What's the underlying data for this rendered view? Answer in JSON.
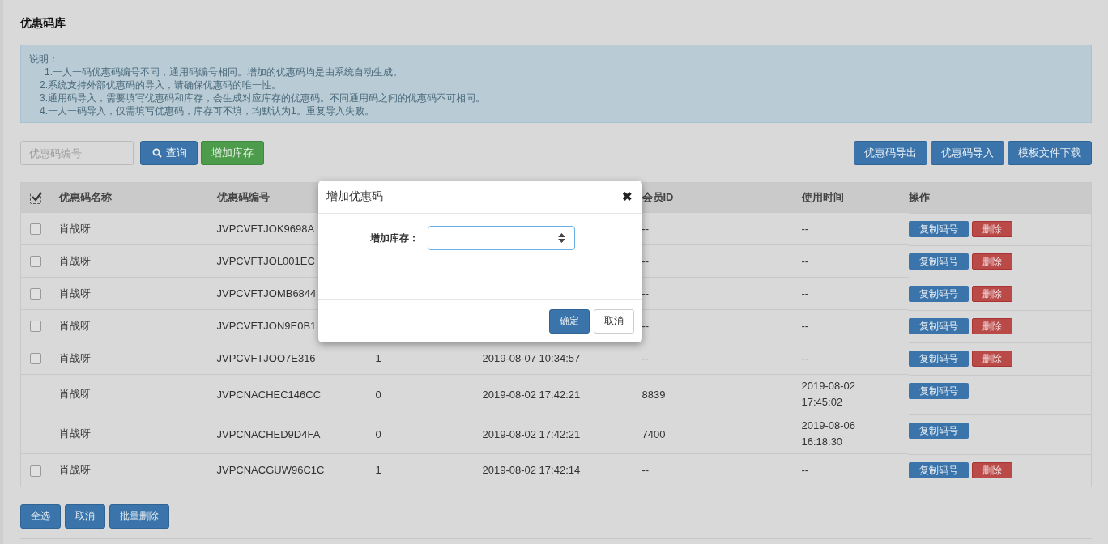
{
  "page_title": "优惠码库",
  "notice": {
    "heading": "说明：",
    "lines": [
      "1.一人一码优惠码编号不同，通用码编号相同。增加的优惠码均是由系统自动生成。",
      "2.系统支持外部优惠码的导入，请确保优惠码的唯一性。",
      "3.通用码导入，需要填写优惠码和库存，会生成对应库存的优惠码。不同通用码之间的优惠码不可相同。",
      "4.一人一码导入，仅需填写优惠码，库存可不填，均默认为1。重复导入失败。"
    ]
  },
  "search": {
    "placeholder": "优惠码编号",
    "query_button": "查询",
    "add_stock_button": "增加库存"
  },
  "toolbar_buttons": [
    "优惠码导出",
    "优惠码导入",
    "模板文件下载"
  ],
  "table": {
    "select_all_checked": true,
    "columns": [
      "优惠码名称",
      "优惠码编号",
      "",
      "",
      "会员ID",
      "使用时间",
      "操作"
    ],
    "rows": [
      {
        "checked": false,
        "name": "肖战呀",
        "code": "JVPCVFTJOK9698A",
        "member_id": "--",
        "used_time": "--",
        "actions": [
          {
            "kind": "copy",
            "label": "复制码号"
          },
          {
            "kind": "delete",
            "label": "删除"
          }
        ]
      },
      {
        "checked": false,
        "name": "肖战呀",
        "code": "JVPCVFTJOL001EC",
        "member_id": "--",
        "used_time": "--",
        "actions": [
          {
            "kind": "copy",
            "label": "复制码号"
          },
          {
            "kind": "delete",
            "label": "删除"
          }
        ]
      },
      {
        "checked": false,
        "name": "肖战呀",
        "code": "JVPCVFTJOMB6844",
        "member_id": "--",
        "used_time": "--",
        "actions": [
          {
            "kind": "copy",
            "label": "复制码号"
          },
          {
            "kind": "delete",
            "label": "删除"
          }
        ]
      },
      {
        "checked": false,
        "name": "肖战呀",
        "code": "JVPCVFTJON9E0B1",
        "member_id": "--",
        "used_time": "--",
        "actions": [
          {
            "kind": "copy",
            "label": "复制码号"
          },
          {
            "kind": "delete",
            "label": "删除"
          }
        ]
      },
      {
        "checked": false,
        "name": "肖战呀",
        "code": "JVPCVFTJOO7E316",
        "column_3": "1",
        "column_4": "2019-08-07 10:34:57",
        "member_id": "--",
        "used_time": "--",
        "actions": [
          {
            "kind": "copy",
            "label": "复制码号"
          },
          {
            "kind": "delete",
            "label": "删除"
          }
        ]
      },
      {
        "name": "肖战呀",
        "code": "JVPCNACHEC146CC",
        "column_3": "0",
        "column_4": "2019-08-02 17:42:21",
        "member_id": "8839",
        "used_time": "2019-08-02 17:45:02",
        "actions": [
          {
            "kind": "copy",
            "label": "复制码号"
          }
        ]
      },
      {
        "name": "肖战呀",
        "code": "JVPCNACHED9D4FA",
        "column_3": "0",
        "column_4": "2019-08-02 17:42:21",
        "member_id": "7400",
        "used_time": "2019-08-06 16:18:30",
        "actions": [
          {
            "kind": "copy",
            "label": "复制码号"
          }
        ]
      },
      {
        "checked": false,
        "name": "肖战呀",
        "code": "JVPCNACGUW96C1C",
        "column_3": "1",
        "column_4": "2019-08-02 17:42:14",
        "member_id": "--",
        "used_time": "--",
        "actions": [
          {
            "kind": "copy",
            "label": "复制码号"
          },
          {
            "kind": "delete",
            "label": "删除"
          }
        ]
      }
    ]
  },
  "bottom_buttons": [
    "全选",
    "取消",
    "批量删除"
  ],
  "dialog": {
    "title": "增加优惠码",
    "close": "✖",
    "field_label": "增加库存：",
    "confirm": "确定",
    "cancel": "取消"
  }
}
